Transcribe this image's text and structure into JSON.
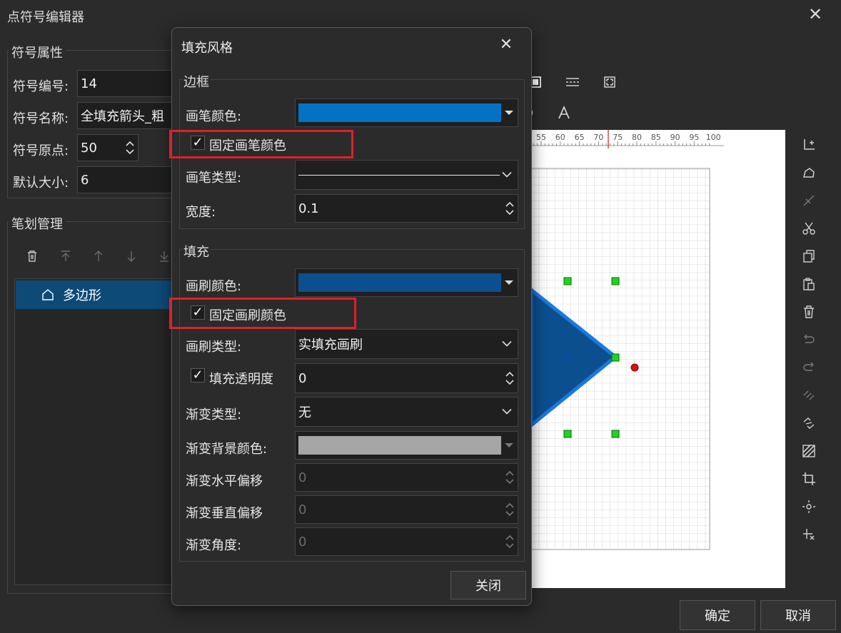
{
  "window": {
    "title": "点符号编辑器",
    "close_glyph": "✕"
  },
  "symbol_props": {
    "group_title": "符号属性",
    "number_label": "符号编号:",
    "number_value": "14",
    "name_label": "符号名称:",
    "name_value": "全填充箭头_粗",
    "origin_label": "符号原点:",
    "origin_value": "50",
    "size_label": "默认大小:",
    "size_value": "6"
  },
  "stroke_mgmt": {
    "group_title": "笔划管理",
    "items": [
      {
        "label": "多边形"
      }
    ]
  },
  "ruler": {
    "ticks": [
      "55",
      "60",
      "65",
      "70",
      "75",
      "80",
      "85",
      "90",
      "95",
      "100"
    ]
  },
  "bottom_buttons": {
    "ok": "确定",
    "cancel": "取消"
  },
  "dialog": {
    "title": "填充风格",
    "close_glyph": "✕",
    "border_section": {
      "title": "边框",
      "pen_color_label": "画笔颜色:",
      "pen_color": "#0472c4",
      "fix_pen_color_label": "固定画笔颜色",
      "fix_pen_color_checked": true,
      "pen_type_label": "画笔类型:",
      "width_label": "宽度:",
      "width_value": "0.1"
    },
    "fill_section": {
      "title": "填充",
      "brush_color_label": "画刷颜色:",
      "brush_color": "#0c4f8f",
      "fix_brush_color_label": "固定画刷颜色",
      "fix_brush_color_checked": true,
      "brush_type_label": "画刷类型:",
      "brush_type_value": "实填充画刷",
      "transparency_label": "填充透明度",
      "transparency_checked": true,
      "transparency_value": "0",
      "gradient_type_label": "渐变类型:",
      "gradient_type_value": "无",
      "gradient_bg_label": "渐变背景颜色:",
      "gradient_bg_color": "#a6a6a6",
      "gradient_hoffset_label": "渐变水平偏移",
      "gradient_hoffset_value": "0",
      "gradient_voffset_label": "渐变垂直偏移",
      "gradient_voffset_value": "0",
      "gradient_angle_label": "渐变角度:",
      "gradient_angle_value": "0"
    },
    "close_button": "关闭"
  },
  "colors": {
    "highlight_red": "#e0202a",
    "selection_blue": "#0e4a78",
    "handle_green": "#1fd41f",
    "origin_red": "#e01010"
  }
}
